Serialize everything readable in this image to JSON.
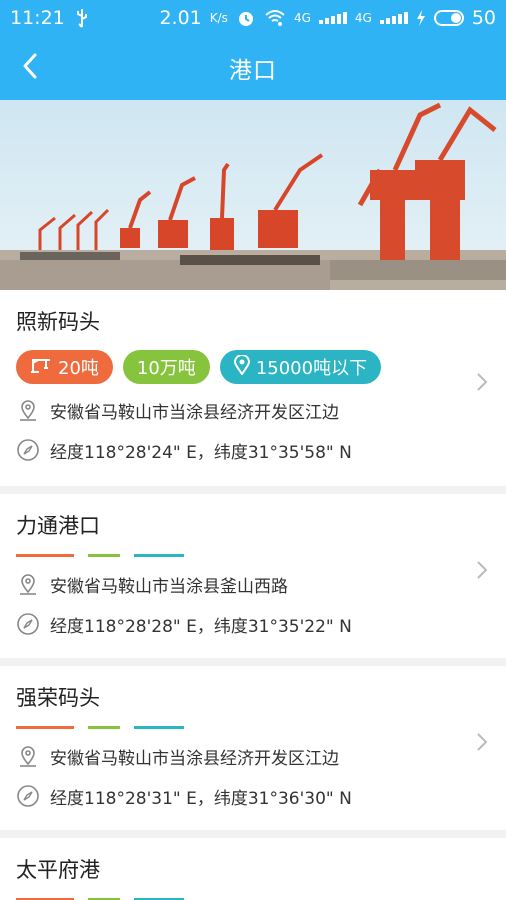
{
  "status_bar": {
    "time": "11:21",
    "speed": "2.01",
    "speed_unit": "K/s",
    "net1": "4G",
    "net2": "4G",
    "battery": "50"
  },
  "nav": {
    "title": "港口",
    "back_icon": "chevron-left-icon"
  },
  "hero": {
    "alt": "port cranes photo"
  },
  "ports": [
    {
      "name": "照新码头",
      "tags": [
        {
          "icon": "crane-icon",
          "label": "20吨"
        },
        {
          "icon": "",
          "label": "10万吨"
        },
        {
          "icon": "location-pin-icon",
          "label": "15000吨以下"
        }
      ],
      "address": "安徽省马鞍山市当涂县经济开发区江边",
      "coords": "经度118°28'24\" E，纬度31°35'58\" N"
    },
    {
      "name": "力通港口",
      "address": "安徽省马鞍山市当涂县釜山西路",
      "coords": "经度118°28'28\" E，纬度31°35'22\" N"
    },
    {
      "name": "强荣码头",
      "address": "安徽省马鞍山市当涂县经济开发区江边",
      "coords": "经度118°28'31\" E，纬度31°36'30\" N"
    },
    {
      "name": "太平府港"
    }
  ],
  "colors": {
    "primary": "#2fb3f5",
    "orange": "#ef6a3d",
    "green": "#86c43d",
    "teal": "#2ab4c4"
  }
}
